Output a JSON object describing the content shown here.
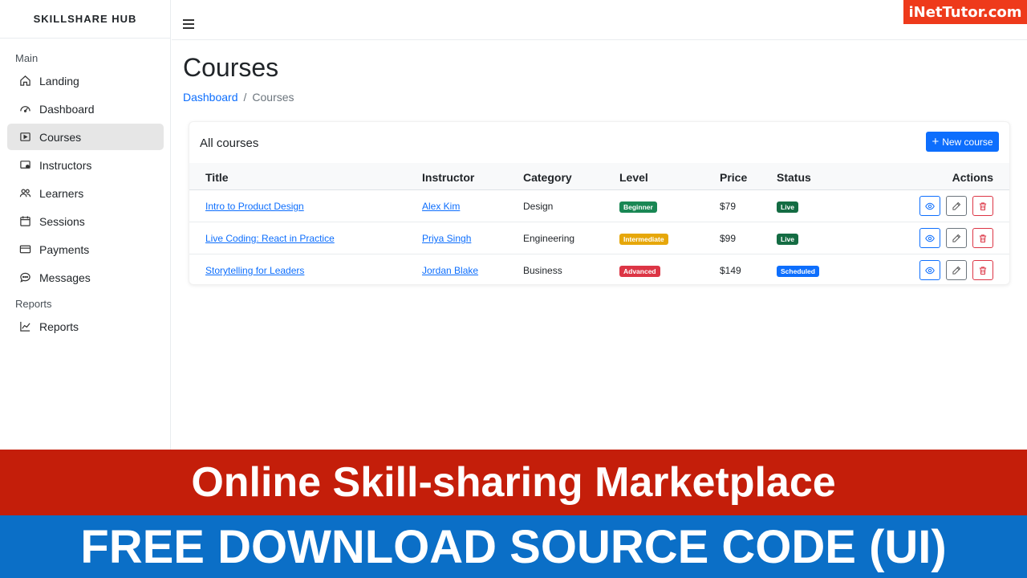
{
  "brand": "SKILLSHARE HUB",
  "watermark": "iNetTutor.com",
  "sidebar": {
    "main_heading": "Main",
    "items": [
      {
        "label": "Landing",
        "icon": "home-icon"
      },
      {
        "label": "Dashboard",
        "icon": "speedometer-icon"
      },
      {
        "label": "Courses",
        "icon": "play-icon"
      },
      {
        "label": "Instructors",
        "icon": "instructor-icon"
      },
      {
        "label": "Learners",
        "icon": "people-icon"
      },
      {
        "label": "Sessions",
        "icon": "calendar-icon"
      },
      {
        "label": "Payments",
        "icon": "card-icon"
      },
      {
        "label": "Messages",
        "icon": "chat-icon"
      }
    ],
    "reports_heading": "Reports",
    "reports_item": {
      "label": "Reports",
      "icon": "graph-icon"
    },
    "active": "Courses"
  },
  "page": {
    "title": "Courses",
    "breadcrumb": {
      "parent": "Dashboard",
      "separator": "/",
      "current": "Courses"
    }
  },
  "card": {
    "title": "All courses",
    "new_button": "New course",
    "columns": [
      "Title",
      "Instructor",
      "Category",
      "Level",
      "Price",
      "Status",
      "Actions"
    ],
    "rows": [
      {
        "title": "Intro to Product Design",
        "instructor": "Alex Kim",
        "category": "Design",
        "level": "Beginner",
        "level_color": "#198754",
        "price": "$79",
        "status": "Live",
        "status_color": "#146c43"
      },
      {
        "title": "Live Coding: React in Practice",
        "instructor": "Priya Singh",
        "category": "Engineering",
        "level": "Intermediate",
        "level_color": "#e6a70a",
        "price": "$99",
        "status": "Live",
        "status_color": "#146c43"
      },
      {
        "title": "Storytelling for Leaders",
        "instructor": "Jordan Blake",
        "category": "Business",
        "level": "Advanced",
        "level_color": "#dc3545",
        "price": "$149",
        "status": "Scheduled",
        "status_color": "#0d6efd"
      }
    ]
  },
  "banner": {
    "line1": "Online Skill-sharing Marketplace",
    "line2": "FREE DOWNLOAD SOURCE CODE (UI)"
  }
}
